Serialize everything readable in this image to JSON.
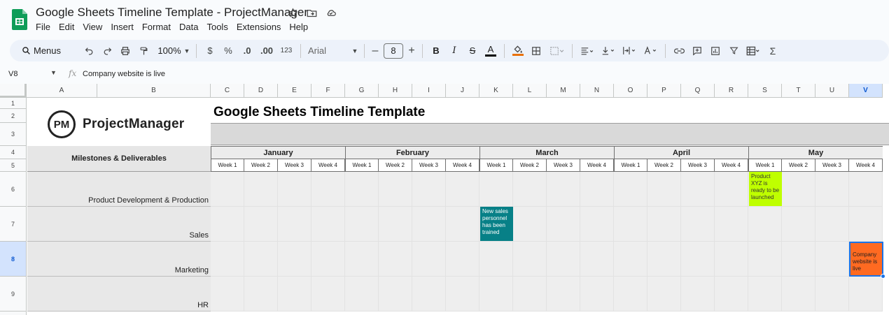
{
  "window": {
    "title": "Google Sheets Timeline Template - ProjectManager"
  },
  "menu": [
    "File",
    "Edit",
    "View",
    "Insert",
    "Format",
    "Data",
    "Tools",
    "Extensions",
    "Help"
  ],
  "toolbar": {
    "menus_label": "Menus",
    "zoom": "100%",
    "currency": "$",
    "percent": "%",
    "dec_decrease": ".0",
    "dec_increase": ".00",
    "number_format": "123",
    "font": "Arial",
    "font_size": "8",
    "bold": "B",
    "italic": "I",
    "strike": "S",
    "text_color": "A",
    "sum": "Σ"
  },
  "formula_bar": {
    "cell_ref": "V8",
    "fx": "fx",
    "value": "Company website is live"
  },
  "columns": [
    "A",
    "B",
    "C",
    "D",
    "E",
    "F",
    "G",
    "H",
    "I",
    "J",
    "K",
    "L",
    "M",
    "N",
    "O",
    "P",
    "Q",
    "R",
    "S",
    "T",
    "U",
    "V"
  ],
  "rows": [
    "1",
    "2",
    "3",
    "4",
    "5",
    "6",
    "7",
    "8",
    "9"
  ],
  "selected": {
    "column": "V",
    "row": "8"
  },
  "logo": {
    "badge": "PM",
    "name": "ProjectManager"
  },
  "sheet_title": "Google Sheets Timeline Template",
  "milestones_header": "Milestones & Deliverables",
  "months": [
    "January",
    "February",
    "March",
    "April",
    "May"
  ],
  "week_label_list": [
    "Week 1",
    "Week 2",
    "Week 3",
    "Week 4",
    "Week 1",
    "Week 2",
    "Week 3",
    "Week 4",
    "Week 1",
    "Week 2",
    "Week 3",
    "Week 4",
    "Week 1",
    "Week 2",
    "Week 3",
    "Week 4",
    "Week 1",
    "Week 2",
    "Week 3",
    "Week 4"
  ],
  "categories": [
    "Product Development & Production",
    "Sales",
    "Marketing",
    "HR"
  ],
  "milestones": [
    {
      "text": "Product XYZ is ready to be launched",
      "color": "#bfff00"
    },
    {
      "text": "New sales personnel has been trained",
      "color": "#078087"
    },
    {
      "text": "Company website is live",
      "color": "#ff6a21"
    }
  ]
}
